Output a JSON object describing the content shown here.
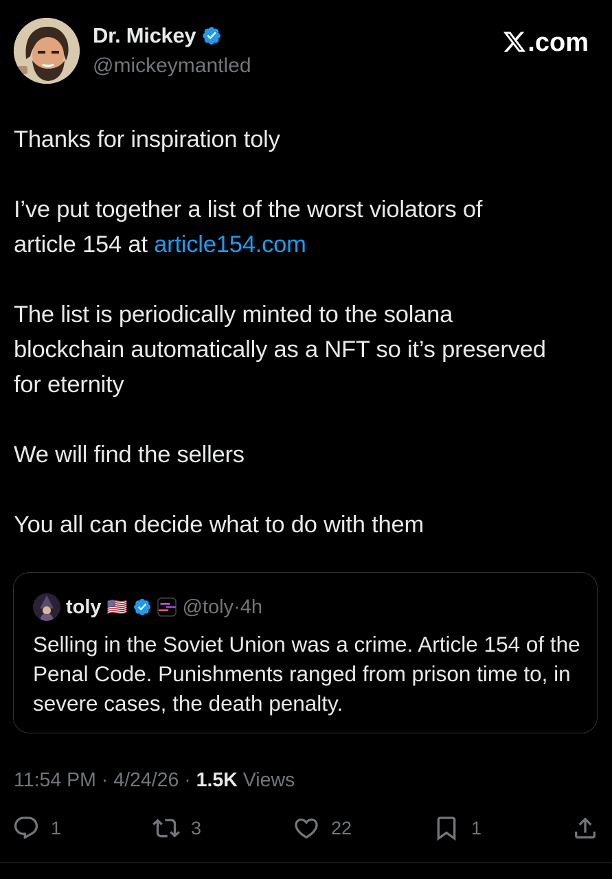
{
  "author": {
    "name": "Dr. Mickey",
    "handle": "@mickeymantled",
    "verified": true
  },
  "brand": {
    "domain": ".com",
    "icon": "x-logo-icon"
  },
  "post": {
    "lines": [
      "Thanks for inspiration toly",
      "I’ve put together a list of the worst violators of",
      "article 154 at ",
      "article154.com",
      "The list is periodically minted to the solana",
      "blockchain automatically as a NFT so it’s preserved",
      "for eternity",
      "We will find the sellers",
      "You all can decide what to do with them"
    ]
  },
  "quoted": {
    "name": "toly",
    "flag": "🇺🇸",
    "handle": "@toly",
    "age": "4h",
    "text": "Selling in the Soviet Union was a crime.  Article 154 of the Penal Code. Punishments ranged from prison time to, in severe cases, the death penalty."
  },
  "meta": {
    "time": "11:54 PM",
    "date": "4/24/26",
    "views_count": "1.5K",
    "views_label": "Views",
    "sep": "·"
  },
  "actions": {
    "replies": "1",
    "reposts": "3",
    "likes": "22",
    "bookmarks": "1"
  },
  "colors": {
    "background": "#000000",
    "text": "#e7e9ea",
    "secondary": "#71767b",
    "link": "#1d9bf0",
    "verified": "#1d9bf0",
    "border": "#2f3336"
  }
}
